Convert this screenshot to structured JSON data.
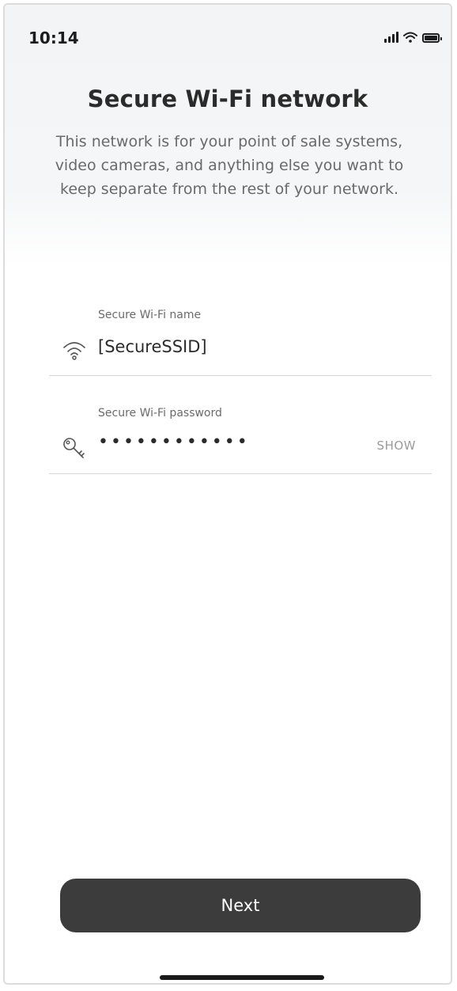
{
  "status_bar": {
    "time": "10:14",
    "icons": [
      "signal-icon",
      "wifi-icon",
      "battery-icon"
    ]
  },
  "header": {
    "title": "Secure Wi-Fi network",
    "subtitle": "This network is for your point of sale systems, video cameras, and anything else you want to keep separate from the rest of your network."
  },
  "form": {
    "name_field": {
      "label": "Secure Wi-Fi name",
      "value": "[SecureSSID]",
      "icon": "wifi-icon"
    },
    "password_field": {
      "label": "Secure Wi-Fi password",
      "masked_value": "••••••••••••",
      "icon": "key-icon",
      "toggle_label": "SHOW"
    }
  },
  "actions": {
    "next_label": "Next"
  },
  "colors": {
    "button_bg": "#3c3c3c",
    "header_bg": "#f2f4f6",
    "text_primary": "#2b2b2b",
    "text_secondary": "#6a6a6a"
  }
}
